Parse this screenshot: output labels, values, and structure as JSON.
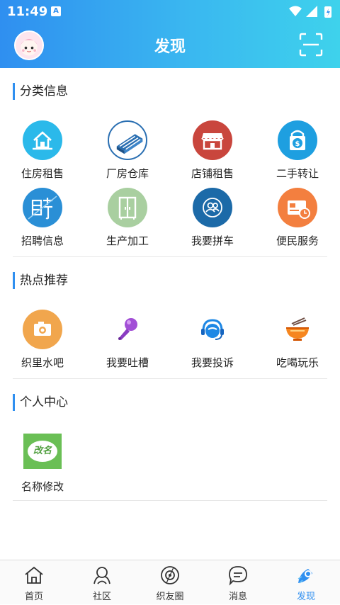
{
  "status_bar": {
    "time": "11:49",
    "notification_letter": "A"
  },
  "header": {
    "title": "发现"
  },
  "sections": [
    {
      "title": "分类信息",
      "items": [
        {
          "label": "住房租售",
          "icon": "house-icon",
          "color": "#2bb9ea"
        },
        {
          "label": "厂房仓库",
          "icon": "factory-icon",
          "color": "#ffffff"
        },
        {
          "label": "店铺租售",
          "icon": "shop-icon",
          "color": "#c9463d"
        },
        {
          "label": "二手转让",
          "icon": "bag-dollar-icon",
          "color": "#1e9fe0"
        },
        {
          "label": "招聘信息",
          "icon": "recruit-icon",
          "color": "#2a8fd6"
        },
        {
          "label": "生产加工",
          "icon": "cabinet-icon",
          "color": "#a9cfa0"
        },
        {
          "label": "我要拼车",
          "icon": "carpool-icon",
          "color": "#1c6aa8"
        },
        {
          "label": "便民服务",
          "icon": "card-clock-icon",
          "color": "#f37f3f"
        }
      ]
    },
    {
      "title": "热点推荐",
      "items": [
        {
          "label": "织里水吧",
          "icon": "camera-icon",
          "color": "#f1a64d"
        },
        {
          "label": "我要吐槽",
          "icon": "microphone-icon",
          "color": "#a24fd6"
        },
        {
          "label": "我要投诉",
          "icon": "headset-icon",
          "color": "#1e88e5"
        },
        {
          "label": "吃喝玩乐",
          "icon": "noodle-bowl-icon",
          "color": "#f6861f"
        }
      ]
    },
    {
      "title": "个人中心",
      "items": [
        {
          "label": "名称修改",
          "icon": "rename-icon",
          "color": "#6abf55",
          "badge_text": "改名"
        }
      ]
    }
  ],
  "tabbar": {
    "tabs": [
      {
        "label": "首页",
        "icon": "home-icon"
      },
      {
        "label": "社区",
        "icon": "community-icon"
      },
      {
        "label": "织友圈",
        "icon": "friends-circle-icon"
      },
      {
        "label": "消息",
        "icon": "message-icon"
      },
      {
        "label": "发现",
        "icon": "discover-icon",
        "active": true
      }
    ]
  }
}
